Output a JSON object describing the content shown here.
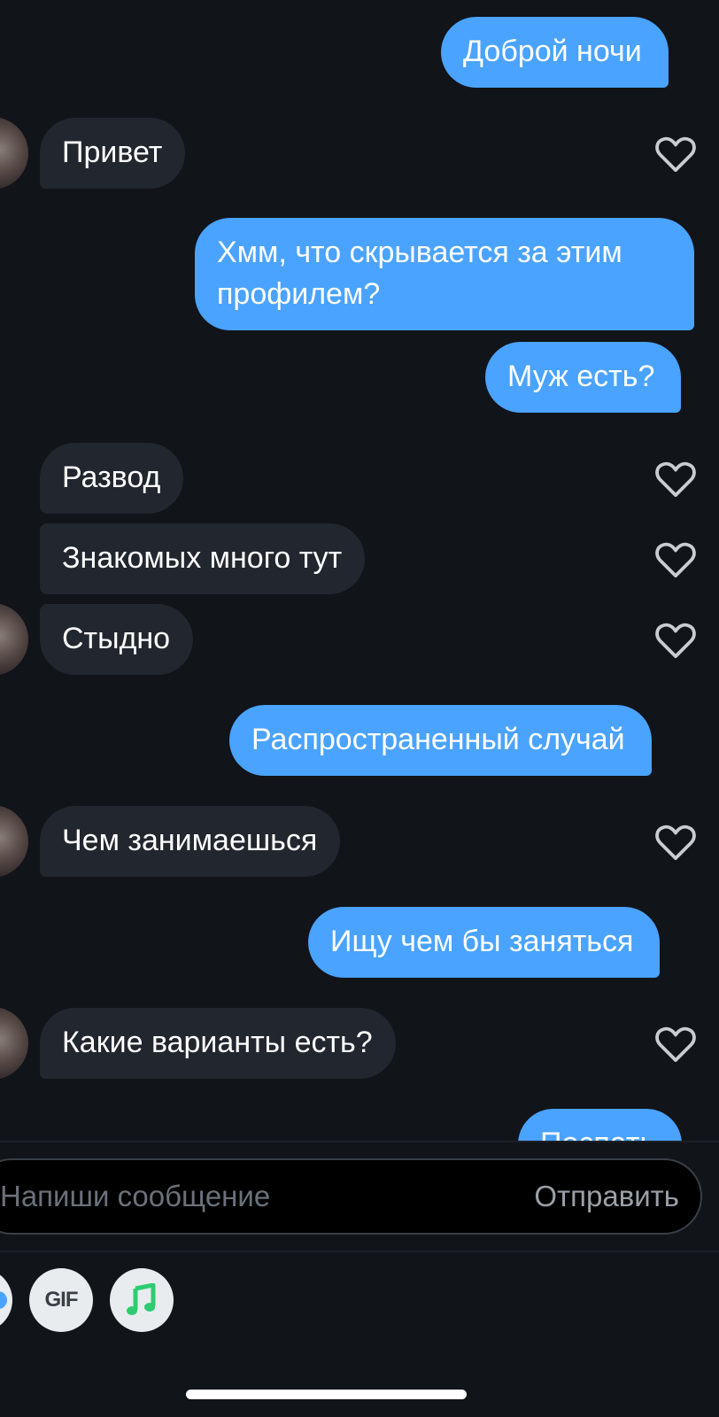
{
  "messages": {
    "m1": "Доброй ночи",
    "m2": "Привет",
    "m3": "Хмм, что скрывается за этим профилем?",
    "m4": "Муж есть?",
    "m5": "Развод",
    "m6": "Знакомых много тут",
    "m7": "Стыдно",
    "m8": "Распространенный случай",
    "m9": "Чем занимаешься",
    "m10": "Ищу чем бы заняться",
    "m11": "Какие варианты есть?",
    "m12": "Поспать"
  },
  "composer": {
    "placeholder": "Напиши сообщение",
    "send_label": "Отправить"
  },
  "tools": {
    "gif_label": "GIF",
    "music_icon": "music-note-icon"
  },
  "colors": {
    "background": "#111419",
    "outgoing_bubble": "#4aa3ff",
    "incoming_bubble": "#22262e",
    "music_icon": "#2ecc71"
  }
}
